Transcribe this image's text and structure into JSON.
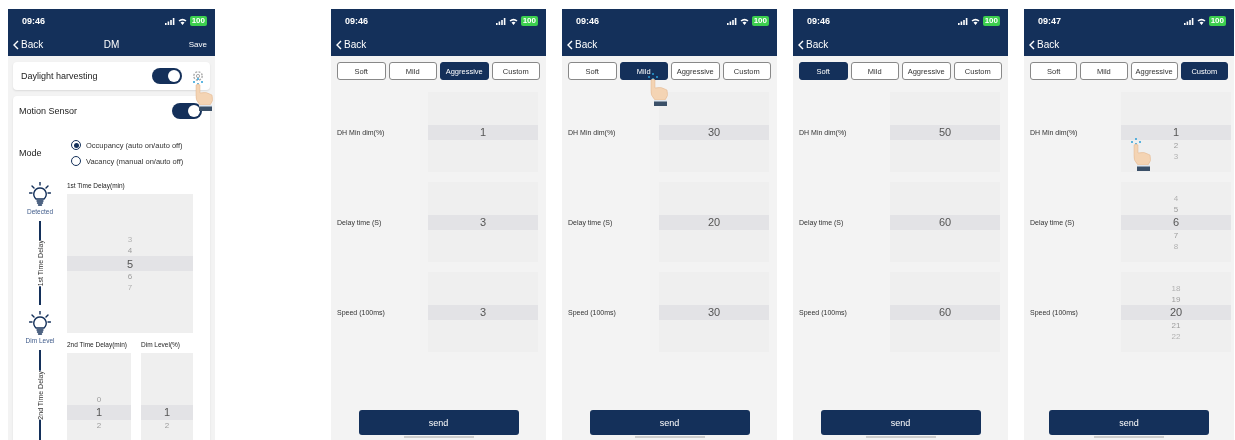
{
  "screens": [
    {
      "kind": "dm",
      "status_bar": {
        "time": "09:46",
        "battery": "100"
      },
      "nav": {
        "back": "Back",
        "title": "DM",
        "action": "Save"
      },
      "daylight_harvesting": {
        "label": "Daylight harvesting",
        "on": true,
        "settings_tapped": true
      },
      "motion_sensor": {
        "label": "Motion Sensor",
        "on": true
      },
      "mode": {
        "label": "Mode",
        "options": [
          {
            "label": "Occupancy (auto on/auto off)",
            "selected": true
          },
          {
            "label": "Vacancy (manual on/auto off)",
            "selected": false
          }
        ]
      },
      "timeline": {
        "first_stage": {
          "label": "Detected",
          "line_label": "1st Time Delay",
          "picker_label": "1st Time Delay(min)",
          "picker": [
            {
              "value": "3",
              "selected": false
            },
            {
              "value": "4",
              "selected": false
            },
            {
              "value": "5",
              "selected": true
            },
            {
              "value": "6",
              "selected": false
            },
            {
              "value": "7",
              "selected": false
            }
          ]
        },
        "second_stage": {
          "label": "Dim Level",
          "line_label": "2nd Time Delay",
          "pickers": [
            {
              "label": "2nd Time Delay(min)",
              "items": [
                {
                  "value": "0",
                  "selected": false
                },
                {
                  "value": "1",
                  "selected": true
                },
                {
                  "value": "2",
                  "selected": false
                }
              ]
            },
            {
              "label": "Dim Level(%)",
              "items": [
                {
                  "value": "1",
                  "selected": true
                },
                {
                  "value": "2",
                  "selected": false
                }
              ]
            }
          ]
        }
      }
    },
    {
      "kind": "preset",
      "status_bar": {
        "time": "09:46",
        "battery": "100"
      },
      "nav": {
        "back": "Back"
      },
      "tabs": [
        {
          "label": "Soft",
          "selected": false,
          "tapped": false
        },
        {
          "label": "Mild",
          "selected": false,
          "tapped": false
        },
        {
          "label": "Aggressive",
          "selected": true,
          "tapped": false
        },
        {
          "label": "Custom",
          "selected": false,
          "tapped": false
        }
      ],
      "rows": [
        {
          "label": "DH Min dim(%)",
          "tapped": false,
          "items": [
            {
              "value": "1",
              "selected": true
            }
          ]
        },
        {
          "label": "Delay time (S)",
          "tapped": false,
          "items": [
            {
              "value": "3",
              "selected": true
            }
          ]
        },
        {
          "label": "Speed (100ms)",
          "tapped": false,
          "items": [
            {
              "value": "3",
              "selected": true
            }
          ]
        }
      ],
      "send": "send"
    },
    {
      "kind": "preset",
      "status_bar": {
        "time": "09:46",
        "battery": "100"
      },
      "nav": {
        "back": "Back"
      },
      "tabs": [
        {
          "label": "Soft",
          "selected": false,
          "tapped": false
        },
        {
          "label": "Mild",
          "selected": true,
          "tapped": true
        },
        {
          "label": "Aggressive",
          "selected": false,
          "tapped": false
        },
        {
          "label": "Custom",
          "selected": false,
          "tapped": false
        }
      ],
      "rows": [
        {
          "label": "DH Min dim(%)",
          "tapped": false,
          "items": [
            {
              "value": "30",
              "selected": true
            }
          ]
        },
        {
          "label": "Delay time (S)",
          "tapped": false,
          "items": [
            {
              "value": "20",
              "selected": true
            }
          ]
        },
        {
          "label": "Speed (100ms)",
          "tapped": false,
          "items": [
            {
              "value": "30",
              "selected": true
            }
          ]
        }
      ],
      "send": "send"
    },
    {
      "kind": "preset",
      "status_bar": {
        "time": "09:46",
        "battery": "100"
      },
      "nav": {
        "back": "Back"
      },
      "tabs": [
        {
          "label": "Soft",
          "selected": true,
          "tapped": false
        },
        {
          "label": "Mild",
          "selected": false,
          "tapped": false
        },
        {
          "label": "Aggressive",
          "selected": false,
          "tapped": false
        },
        {
          "label": "Custom",
          "selected": false,
          "tapped": false
        }
      ],
      "rows": [
        {
          "label": "DH Min dim(%)",
          "tapped": false,
          "items": [
            {
              "value": "50",
              "selected": true
            }
          ]
        },
        {
          "label": "Delay time (S)",
          "tapped": false,
          "items": [
            {
              "value": "60",
              "selected": true
            }
          ]
        },
        {
          "label": "Speed (100ms)",
          "tapped": false,
          "items": [
            {
              "value": "60",
              "selected": true
            }
          ]
        }
      ],
      "send": "send"
    },
    {
      "kind": "preset",
      "status_bar": {
        "time": "09:47",
        "battery": "100"
      },
      "nav": {
        "back": "Back"
      },
      "tabs": [
        {
          "label": "Soft",
          "selected": false,
          "tapped": false
        },
        {
          "label": "Mild",
          "selected": false,
          "tapped": false
        },
        {
          "label": "Aggressive",
          "selected": false,
          "tapped": false
        },
        {
          "label": "Custom",
          "selected": true,
          "tapped": false
        }
      ],
      "rows": [
        {
          "label": "DH Min dim(%)",
          "tapped": true,
          "items": [
            {
              "value": "1",
              "selected": true
            },
            {
              "value": "2",
              "selected": false
            },
            {
              "value": "3",
              "selected": false
            }
          ]
        },
        {
          "label": "Delay time (S)",
          "tapped": false,
          "items": [
            {
              "value": "4",
              "selected": false
            },
            {
              "value": "5",
              "selected": false
            },
            {
              "value": "6",
              "selected": true
            },
            {
              "value": "7",
              "selected": false
            },
            {
              "value": "8",
              "selected": false
            }
          ]
        },
        {
          "label": "Speed (100ms)",
          "tapped": false,
          "items": [
            {
              "value": "18",
              "selected": false
            },
            {
              "value": "19",
              "selected": false
            },
            {
              "value": "20",
              "selected": true
            },
            {
              "value": "21",
              "selected": false
            },
            {
              "value": "22",
              "selected": false
            }
          ]
        }
      ],
      "send": "send"
    }
  ]
}
